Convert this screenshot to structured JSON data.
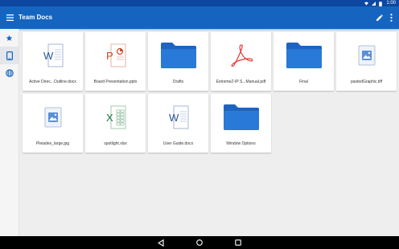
{
  "status": {
    "time": "1:00"
  },
  "appbar": {
    "title": "Team Docs"
  },
  "sidebar": {
    "items": [
      {
        "icon": "star-icon",
        "name": "starred"
      },
      {
        "icon": "tablet-icon",
        "name": "device"
      },
      {
        "icon": "globe-icon",
        "name": "network"
      }
    ]
  },
  "files": [
    {
      "name": "Active Direc...Outline.docx",
      "type": "word"
    },
    {
      "name": "Board Presentation.pptx",
      "type": "powerpoint"
    },
    {
      "name": "Drafts",
      "type": "folder"
    },
    {
      "name": "ExtremeZ-IP S...Manual.pdf",
      "type": "pdf"
    },
    {
      "name": "Final",
      "type": "folder"
    },
    {
      "name": "pastedGraphic.tiff",
      "type": "image"
    },
    {
      "name": "Pleiades_large.jpg",
      "type": "image"
    },
    {
      "name": "spotlight.xlsx",
      "type": "excel"
    },
    {
      "name": "User Guide.docx",
      "type": "word"
    },
    {
      "name": "Window Options",
      "type": "folder"
    }
  ],
  "colors": {
    "appbar": "#1565c0",
    "statusbar": "#0d47a1",
    "folder": "#2979d8",
    "word": "#2b5797",
    "powerpoint": "#d24726",
    "excel": "#1e7145",
    "pdf": "#e53935"
  }
}
